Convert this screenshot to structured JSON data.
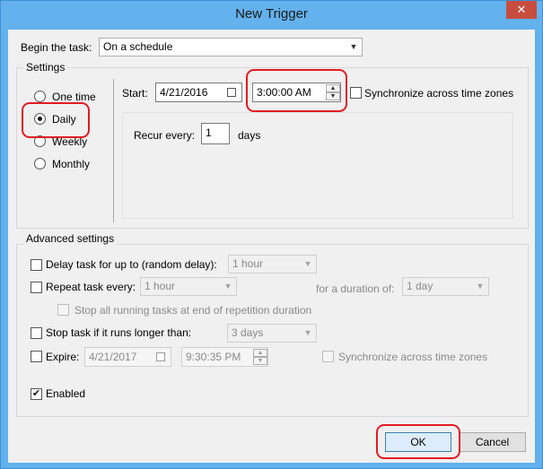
{
  "window": {
    "title": "New Trigger",
    "close_glyph": "✕"
  },
  "begin": {
    "label": "Begin the task:",
    "value": "On a schedule"
  },
  "settings": {
    "title": "Settings",
    "options": [
      "One time",
      "Daily",
      "Weekly",
      "Monthly"
    ],
    "selected": "Daily",
    "start_label": "Start:",
    "start_date": "4/21/2016",
    "start_time": "3:00:00 AM",
    "sync_label": "Synchronize across time zones",
    "recur_label": "Recur every:",
    "recur_value": "1",
    "recur_unit": "days"
  },
  "advanced": {
    "title": "Advanced settings",
    "delay_label": "Delay task for up to (random delay):",
    "delay_value": "1 hour",
    "repeat_label": "Repeat task every:",
    "repeat_value": "1 hour",
    "duration_label": "for a duration of:",
    "duration_value": "1 day",
    "stop_running_label": "Stop all running tasks at end of repetition duration",
    "stop_longer_label": "Stop task if it runs longer than:",
    "stop_longer_value": "3 days",
    "expire_label": "Expire:",
    "expire_date": "4/21/2017",
    "expire_time": "9:30:35 PM",
    "expire_sync_label": "Synchronize across time zones",
    "enabled_label": "Enabled",
    "check_glyph": "✔"
  },
  "buttons": {
    "ok": "OK",
    "cancel": "Cancel"
  },
  "glyphs": {
    "dropdown": "▼",
    "spin_up": "▲",
    "spin_down": "▼"
  },
  "colors": {
    "highlight": "#e11b22",
    "titlebar": "#63b1ed",
    "close": "#c74d3f"
  }
}
